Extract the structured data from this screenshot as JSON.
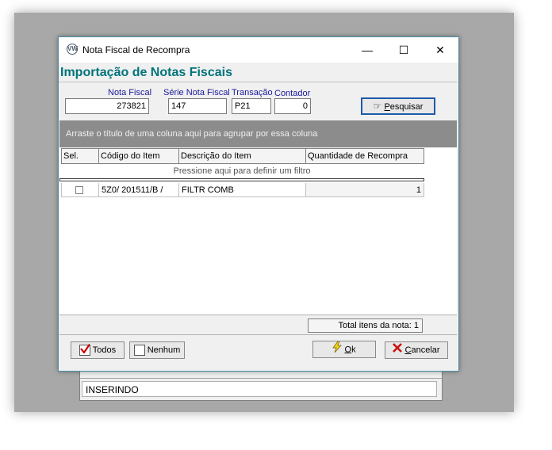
{
  "window": {
    "title": "Nota Fiscal de Recompra",
    "minimize": "—",
    "maximize": "☐",
    "close": "✕",
    "icon_text": "VW"
  },
  "heading": "Importação de Notas Fiscais",
  "fields": {
    "nota_fiscal": {
      "label": "Nota Fiscal",
      "value": "273821"
    },
    "serie": {
      "label": "Série Nota Fiscal",
      "value": "147"
    },
    "transacao": {
      "label": "Transação",
      "value": "P21"
    },
    "contador": {
      "label": "Contador",
      "value": "0"
    }
  },
  "search_button": {
    "label": "Pesquisar",
    "accel": "P",
    "rest": "esquisar"
  },
  "group_hint": "Arraste o título de uma coluna aqui para agrupar por essa coluna",
  "grid": {
    "columns": [
      "Sel.",
      "Código do Item",
      "Descrição do Item",
      "Quantidade de Recompra"
    ],
    "filter_hint": "Pressione aqui para definir um filtro",
    "rows": [
      {
        "codigo": "5Z0/  201511/B /",
        "descricao": "FILTR COMB",
        "quantidade": "1"
      }
    ],
    "total_label": "Total itens da nota: 1"
  },
  "buttons": {
    "todos": "Todos",
    "nenhum": "Nenhum",
    "ok_accel": "O",
    "ok_rest": "k",
    "cancelar_accel": "C",
    "cancelar_rest": "ancelar"
  },
  "background_status": "INSERINDO",
  "colors": {
    "heading": "#00747a",
    "label": "#1a1a9c",
    "group_bar": "#8c8c8c"
  }
}
